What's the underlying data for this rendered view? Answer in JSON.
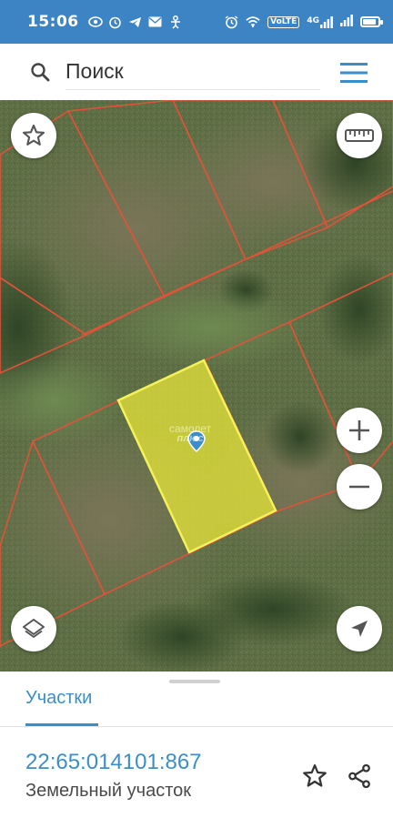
{
  "status_bar": {
    "time": "15:06",
    "left_icons": [
      "eye-icon",
      "alarm-icon",
      "telegram-icon",
      "mail-icon",
      "accessibility-icon"
    ],
    "right_icons": [
      "alarm-clock-icon",
      "wifi-icon",
      "volte-icon",
      "4g-signal-icon",
      "signal-icon",
      "battery-icon"
    ],
    "volte_label": "VoLTE",
    "network_label": "4G",
    "battery_level": 0.85
  },
  "search": {
    "placeholder": "Поиск"
  },
  "map": {
    "watermark_line1": "самолет",
    "watermark_line2": "плюс",
    "selected_parcel_color": "#e5e43a",
    "parcel_border_color": "#e0533a",
    "marker_color": "#3b8ec9"
  },
  "sheet": {
    "tab_label": "Участки",
    "parcel_number": "22:65:014101:867",
    "parcel_type": "Земельный участок"
  },
  "colors": {
    "status_bar": "#3d84c5",
    "accent": "#3b8ec9"
  }
}
